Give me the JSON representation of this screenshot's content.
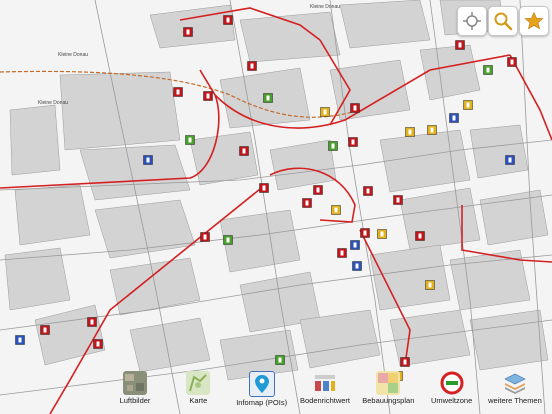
{
  "map": {
    "street_labels": [
      "Kleine Donau",
      "Kleine Donau",
      "Kleine Donau"
    ]
  },
  "controls": {
    "locate_icon": "locate-crosshair-icon",
    "search_icon": "magnifier-icon",
    "favorites_icon": "star-icon"
  },
  "toolbar": {
    "items": [
      {
        "label": "Luftbilder",
        "icon": "aerial-photo-icon"
      },
      {
        "label": "Karte",
        "icon": "map-icon"
      },
      {
        "label": "Infomap (POIs)",
        "icon": "poi-pin-icon"
      },
      {
        "label": "Bodenrichtwert",
        "icon": "land-value-icon"
      },
      {
        "label": "Bebauungsplan",
        "icon": "zoning-plan-icon"
      },
      {
        "label": "Umweltzone",
        "icon": "environment-zone-icon"
      },
      {
        "label": "weitere Themen",
        "icon": "layers-icon"
      }
    ]
  },
  "colors": {
    "boundary": "#d42020",
    "rail": "#c46a2a",
    "building": "#cfcfcf",
    "poi_red": "#c0161b",
    "poi_green": "#4aa02c",
    "poi_blue": "#2a52b8",
    "poi_yellow": "#e2b21c"
  }
}
